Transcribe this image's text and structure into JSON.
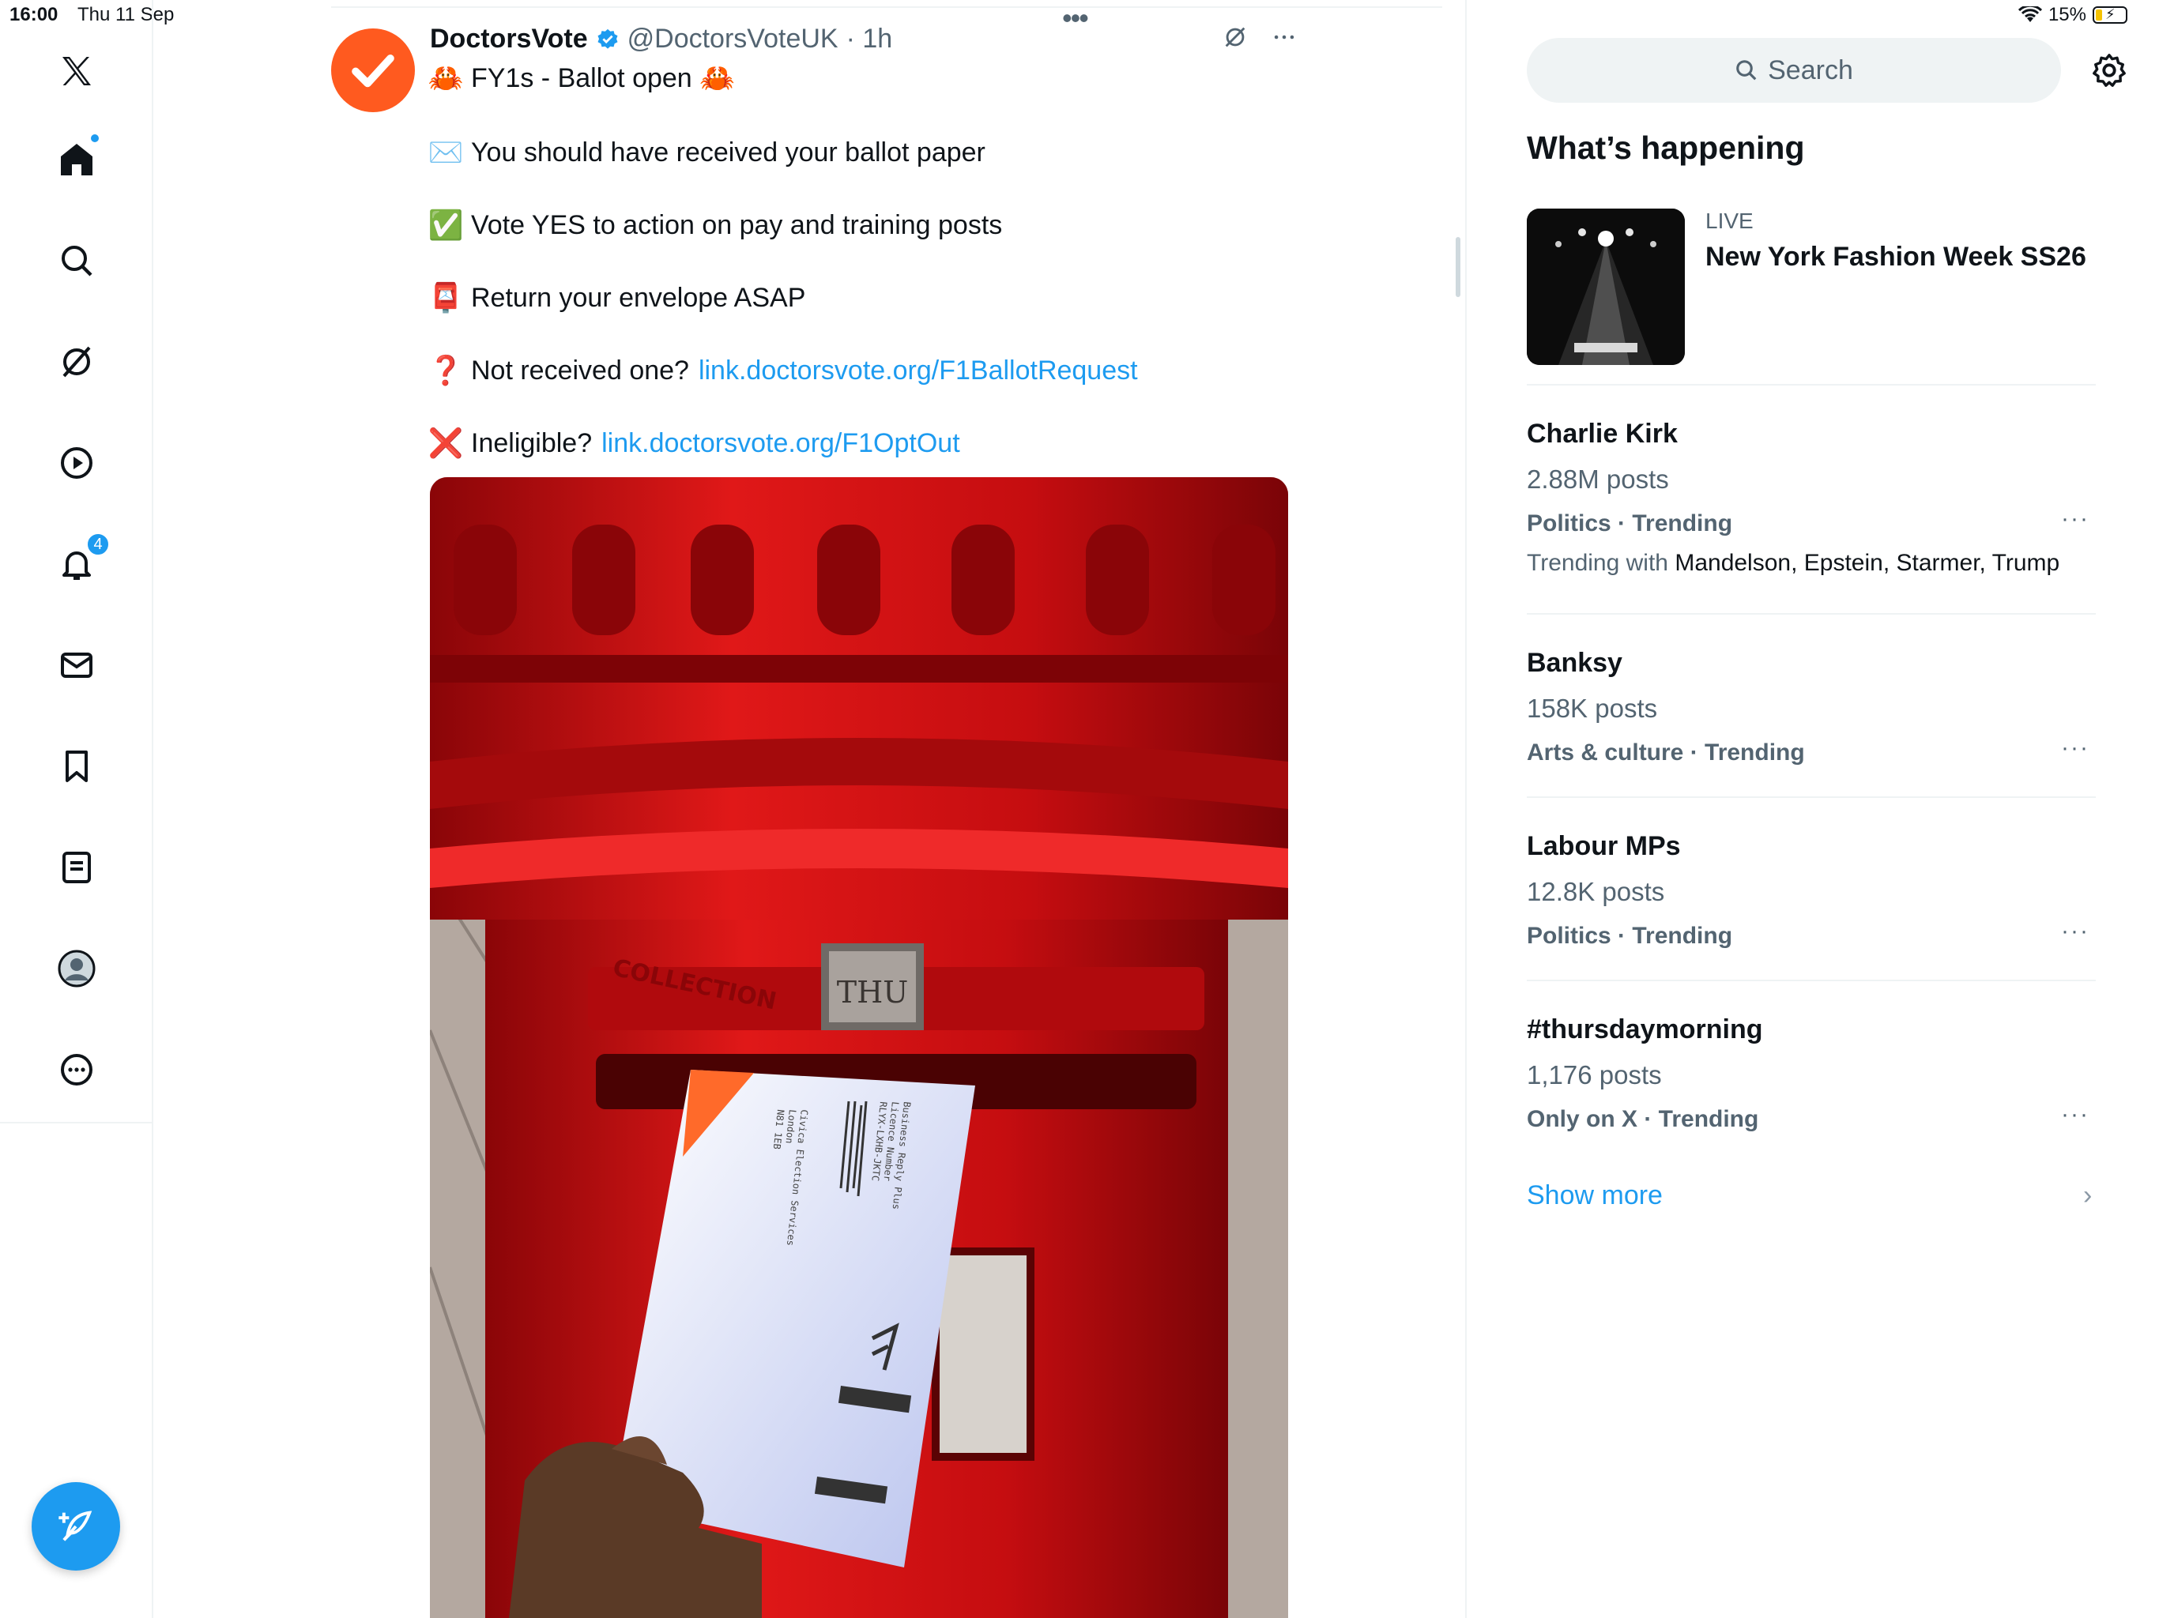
{
  "status_bar": {
    "time": "16:00",
    "date": "Thu 11 Sep",
    "battery": "15%"
  },
  "nav": {
    "items": [
      {
        "name": "home",
        "label": "Home"
      },
      {
        "name": "explore",
        "label": "Explore"
      },
      {
        "name": "grok",
        "label": "Grok"
      },
      {
        "name": "video",
        "label": "Video"
      },
      {
        "name": "notifications",
        "label": "Notifications",
        "badge": "4"
      },
      {
        "name": "messages",
        "label": "Messages"
      },
      {
        "name": "bookmarks",
        "label": "Bookmarks"
      },
      {
        "name": "lists",
        "label": "Lists"
      },
      {
        "name": "profile",
        "label": "Profile"
      },
      {
        "name": "more",
        "label": "More"
      }
    ]
  },
  "tweet": {
    "name": "DoctorsVote",
    "handle": "@DoctorsVoteUK",
    "time": "· 1h",
    "headline": "FY1s - Ballot open",
    "lines": [
      {
        "emoji": "✉️",
        "text": "You should have received your ballot paper",
        "link": ""
      },
      {
        "emoji": "✅",
        "text": "Vote YES to action on pay and training posts",
        "link": ""
      },
      {
        "emoji": "📮",
        "text": "Return your envelope ASAP",
        "link": ""
      },
      {
        "emoji": "❓",
        "text": "Not received one?",
        "link": "link.doctorsvote.org/F1BallotRequest"
      },
      {
        "emoji": "❌",
        "text": "Ineligible?",
        "link": "link.doctorsvote.org/F1OptOut"
      }
    ],
    "image_text": {
      "postbox_plate": "THU",
      "postbox_label": "COLLECTION",
      "envelope_lines": [
        "Business Reply Plus",
        "Licence Number",
        "RLYX-LXHB-JKTC",
        "Civica Election Services",
        "London",
        "N81 1EB"
      ]
    }
  },
  "sidebar": {
    "search_placeholder": "Search",
    "heading": "What’s happening",
    "live_label": "LIVE",
    "live_title": "New York Fashion Week SS26",
    "trends": [
      {
        "title": "Charlie Kirk",
        "count": "2.88M posts",
        "category": "Politics · Trending",
        "with_label": "Trending with",
        "with": "Mandelson, Epstein, Starmer, Trump"
      },
      {
        "title": "Banksy",
        "count": "158K posts",
        "category": "Arts & culture · Trending"
      },
      {
        "title": "Labour MPs",
        "count": "12.8K posts",
        "category": "Politics · Trending"
      },
      {
        "title": "#thursdaymorning",
        "count": "1,176 posts",
        "category": "Only on X · Trending"
      }
    ],
    "show_more": "Show more"
  },
  "colors": {
    "accent": "#1d9bf0",
    "avatar": "#ff5a1f",
    "postbox": "#c80c0c"
  }
}
